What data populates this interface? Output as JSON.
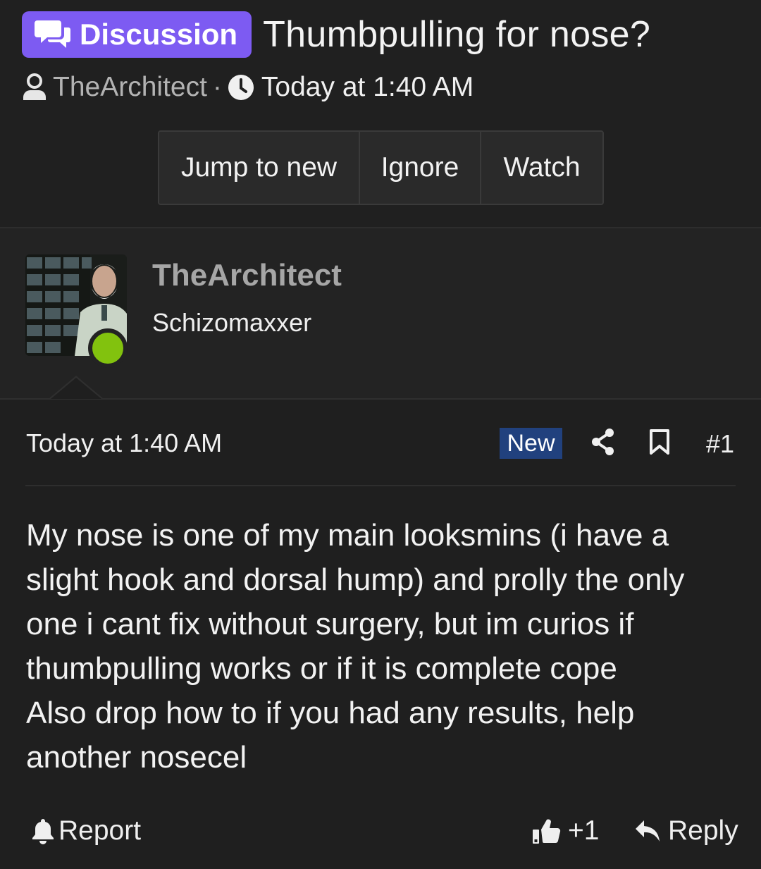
{
  "thread": {
    "badge_label": "Discussion",
    "title": "Thumbpulling for nose?",
    "author": "TheArchitect",
    "separator": "·",
    "time": "Today at 1:40 AM"
  },
  "actions": {
    "jump_to_new": "Jump to new",
    "ignore": "Ignore",
    "watch": "Watch"
  },
  "user": {
    "name": "TheArchitect",
    "title": "Schizomaxxer",
    "online": true
  },
  "post": {
    "time": "Today at 1:40 AM",
    "new_label": "New",
    "number": "#1",
    "lines": [
      "My nose is one of my main looksmins (i have a",
      "slight hook and dorsal hump) and prolly the only",
      "one i cant fix without surgery, but im curios if",
      "thumbpulling works or if it is complete cope",
      "Also drop how to if you had any results, help",
      "another nosecel"
    ]
  },
  "footer": {
    "report": "Report",
    "like_count": "+1",
    "reply": "Reply"
  },
  "colors": {
    "badge": "#7d5bf2",
    "new_badge": "#21417e",
    "online": "#82c20e",
    "background": "#1f1f1f"
  }
}
